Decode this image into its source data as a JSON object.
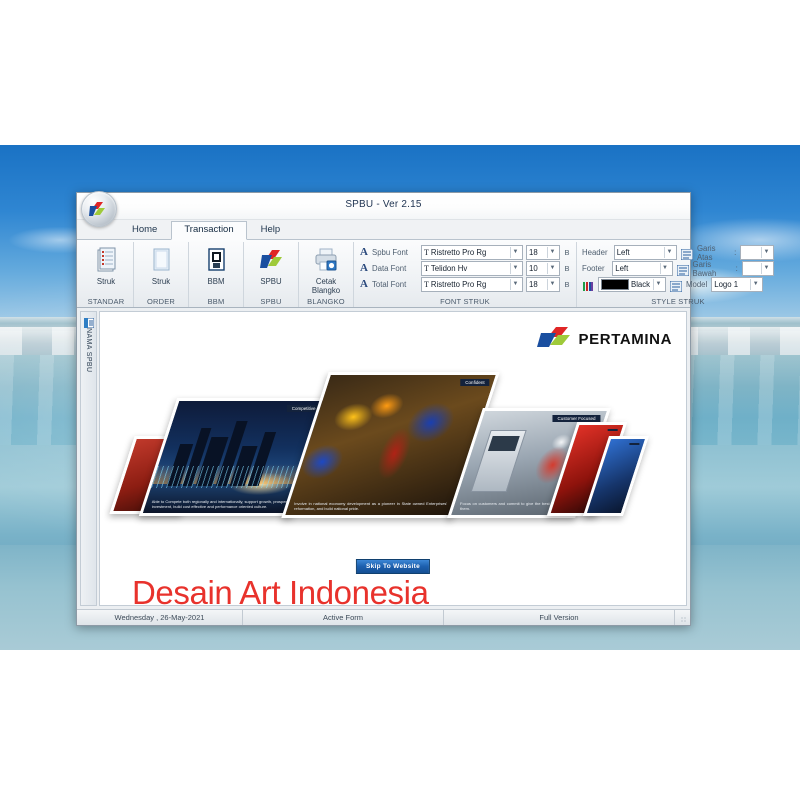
{
  "window": {
    "title": "SPBU - Ver 2.15",
    "logo_icon": "pertamina-orb-icon"
  },
  "tabs": [
    {
      "label": "Home",
      "active": false
    },
    {
      "label": "Transaction",
      "active": true
    },
    {
      "label": "Help",
      "active": false
    }
  ],
  "ribbon": {
    "buttons": [
      {
        "label": "Struk",
        "group": "STANDAR",
        "icon": "document-list-icon"
      },
      {
        "label": "Struk",
        "group": "ORDER",
        "icon": "blank-page-icon"
      },
      {
        "label": "BBM",
        "group": "BBM",
        "icon": "fuel-dispenser-icon"
      },
      {
        "label": "SPBU",
        "group": "SPBU",
        "icon": "pertamina-arrow-icon"
      },
      {
        "label": "Cetak Blangko",
        "group": "BLANGKO",
        "icon": "printer-icon"
      }
    ],
    "font_group": {
      "title": "FONT STRUK",
      "rows": [
        {
          "icon": "font-a-icon",
          "label": "Spbu Font",
          "font": "Ristretto Pro Rg",
          "size": "18",
          "bold_flag": "B"
        },
        {
          "icon": "font-a-icon",
          "label": "Data Font",
          "font": "Telidon Hv",
          "size": "10",
          "bold_flag": "B"
        },
        {
          "icon": "font-a-icon",
          "label": "Total Font",
          "font": "Ristretto Pro Rg",
          "size": "18",
          "bold_flag": "B"
        }
      ]
    },
    "style_group": {
      "title": "STYLE STRUK",
      "header_label": "Header",
      "header_value": "Left",
      "footer_label": "Footer",
      "footer_value": "Left",
      "color_icon": "color-palette-icon",
      "color_value": "Black",
      "color_hex": "#000000",
      "garis_atas_label": "Garis Atas",
      "garis_atas_sep": ":",
      "garis_atas_value": "single-line",
      "garis_bawah_label": "Garis Bawah",
      "garis_bawah_sep": ":",
      "garis_bawah_value": "double-line",
      "model_label": "Model",
      "model_value": "Logo 1",
      "line_icon": "line-style-icon"
    }
  },
  "sidebar": {
    "tab_label": "NAMA SPBU",
    "tab_icon": "list-panel-icon"
  },
  "splash": {
    "brand": "PERTAMINA",
    "brand_logo_icon": "pertamina-arrow-icon",
    "skip_button": "Skip To Website",
    "watermark": "Desain Art Indonesia",
    "panels": [
      {
        "tag": "",
        "body": "",
        "theme": "p-red"
      },
      {
        "tag": "Competitive",
        "body": "Able to Compete both regionally and internationally, support growth, prosper, investment, build cost effective and performance oriented culture.",
        "theme": "p-city"
      },
      {
        "tag": "Confident",
        "body": "Involve in national economy development as a pioneer in State owned Enterprises' reformation, and build national pride.",
        "theme": "p-worker"
      },
      {
        "tag": "Customer Focused",
        "body": "Focus on customers and commit to give the best service for them.",
        "theme": "p-pump"
      },
      {
        "tag": "",
        "body": "",
        "theme": "p-red2"
      },
      {
        "tag": "",
        "body": "",
        "theme": "p-blue"
      }
    ]
  },
  "statusbar": {
    "date": "Wednesday , 26-May-2021",
    "form_state": "Active Form",
    "version": "Full Version",
    "grip_icon": "resize-grip-icon"
  },
  "colors": {
    "pertamina_blue": "#1a4fa0",
    "pertamina_green": "#9fca3a",
    "pertamina_red": "#e02626",
    "watermark_red": "#e8322c",
    "accent_blue": "#1c5fae"
  }
}
